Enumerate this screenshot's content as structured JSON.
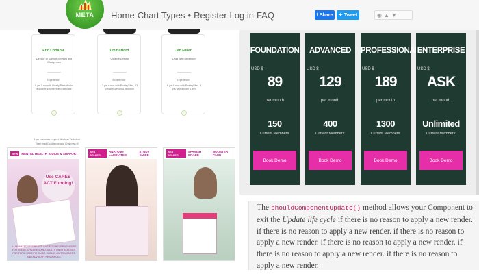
{
  "header": {
    "logo_text": "META",
    "nav": [
      "Home",
      "Chart Types",
      "•",
      "Register",
      "Log in",
      "FAQ"
    ],
    "share": {
      "facebook_label": "Share",
      "twitter_label": "Tweet"
    }
  },
  "team": [
    {
      "name": "Erin Cortazar",
      "role": "Director of Support Services and Chairperson",
      "experience_label": "Experience:",
      "experience": "8 yrs 1 mo with Pixefly/Bites Works a quarter Engineer at Showcase"
    },
    {
      "name": "Tim Burford",
      "role": "Creative Director",
      "experience_label": "Experience:",
      "experience": "7 yrs a mos with PixelsySites, 13 yrs web design & direction"
    },
    {
      "name": "Jen Fuller",
      "role": "Lead Web Developer",
      "experience_label": "Experience:",
      "experience": "6 yrs 8 mos with PixelsySites, 9 yrs web design & dev"
    }
  ],
  "team_overflow_text": "8 yrs customer support. Work as Technical Team lead Co-director and Chairman of society",
  "products": [
    {
      "badge": "NEW",
      "title": "MENTAL HEALTH",
      "subtitle": "GUIDE & SUPPORT",
      "callout": "Use CARES ACT Funding!",
      "caption": "A LAMINATED REFERENCE GUIDE TO HELP PROVIDERS FOR TEENS, CHILDREN, AND ADULTS ON STRATEGIES FOR TOPIC SPECIFIC GUIDE CLINICS ON TREATMENT AND ADVISORY RESOURCES"
    },
    {
      "badge": "BEST SELLER",
      "title": "ANATOMY LAMINATED",
      "subtitle": "STUDY GUIDE",
      "callout": "",
      "caption": ""
    },
    {
      "badge": "BEST SELLER",
      "title": "SPANISH GRADE",
      "subtitle": "BOOSTER PACK",
      "callout": "",
      "caption": ""
    }
  ],
  "pricing": {
    "currency_label": "USD $",
    "per_label": "per month",
    "members_label": "Current Members'",
    "button_label": "Book Demo",
    "plans": [
      {
        "name": "FOUNDATION",
        "price": "89",
        "members": "150"
      },
      {
        "name": "ADVANCED",
        "price": "129",
        "members": "400"
      },
      {
        "name": "PROFESSIONAL",
        "price": "189",
        "members": "1300"
      },
      {
        "name": "ENTERPRISE",
        "price": "ASK",
        "members": "Unlimited"
      }
    ]
  },
  "doc": {
    "intro": "The",
    "code": "shouldComponentUpdate()",
    "text1": "method allows your Component to exit the",
    "emphasis": "Update life cycle",
    "text2": "if there is no reason to apply a new render. if there is no reason to apply a new render. if there is no reason to apply a new render. if there is no reason to apply a new render. if there is no reason to apply a new render. if there is no reason to apply a new render."
  },
  "colors": {
    "plan_bg": "#1f3a30",
    "demo_button": "#e62ea8",
    "accent_green": "#3a9a33"
  }
}
